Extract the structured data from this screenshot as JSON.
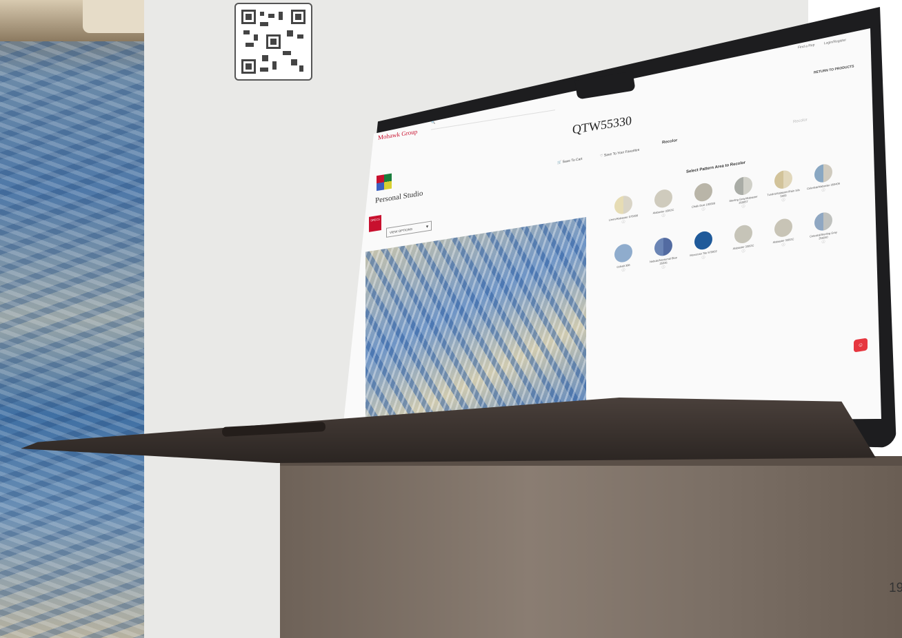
{
  "qr": {
    "icon": "qr-code-icon"
  },
  "app": {
    "brand": "Mohawk Group",
    "brand_suffix": "",
    "search_placeholder": "",
    "find_rep": "Find a Rep",
    "login": "Login/Register",
    "return_link": "RETURN TO PRODUCTS",
    "product_title": "QTW55330",
    "studio_name": "Personal Studio",
    "save_cart": "Save To Cart",
    "save_fav": "Save To Your Favorites",
    "tab_recolor": "Recolor",
    "tab_recolor2": "Recolor",
    "specs": "SPECS",
    "view_options": "VIEW OPTIONS",
    "subhead": "Select Pattern Area to Recolor",
    "chat_icon": "chat-icon"
  },
  "swatches": [
    {
      "label": "Linen/Alabaster 075008",
      "color": "#e6dcb4",
      "color2": "#d9d4c6"
    },
    {
      "label": "Alabaster 330OC",
      "color": "#cfcbbd"
    },
    {
      "label": "Chalk Dust 100009",
      "color": "#b9b5a8"
    },
    {
      "label": "Sterling Gray/Alabaster 250057",
      "color": "#a9aca6",
      "color2": "#d0d0c8"
    },
    {
      "label": "Tundra/Alabaster/Rain Sils 5009",
      "color": "#d2c39a",
      "color2": "#e1d7bb"
    },
    {
      "label": "Celestial/Alabaster 350409",
      "color": "#89a7c2",
      "color2": "#cfcabe"
    },
    {
      "label": "Cobalt 386",
      "color": "#8faccd"
    },
    {
      "label": "Nebula/Nocturnal Blue 25035",
      "color": "#6b85b5",
      "color2": "#536ba1"
    },
    {
      "label": "Moroccan Tile 570002",
      "color": "#1f5a9a"
    },
    {
      "label": "Alabaster 330OC",
      "color": "#c6c4b8"
    },
    {
      "label": "Alabaster 330OC",
      "color": "#c8c4b6"
    },
    {
      "label": "Celestial/Sterling Gray 255040",
      "color": "#8fa7c2",
      "color2": "#bfc1be"
    }
  ],
  "page_number": "19"
}
